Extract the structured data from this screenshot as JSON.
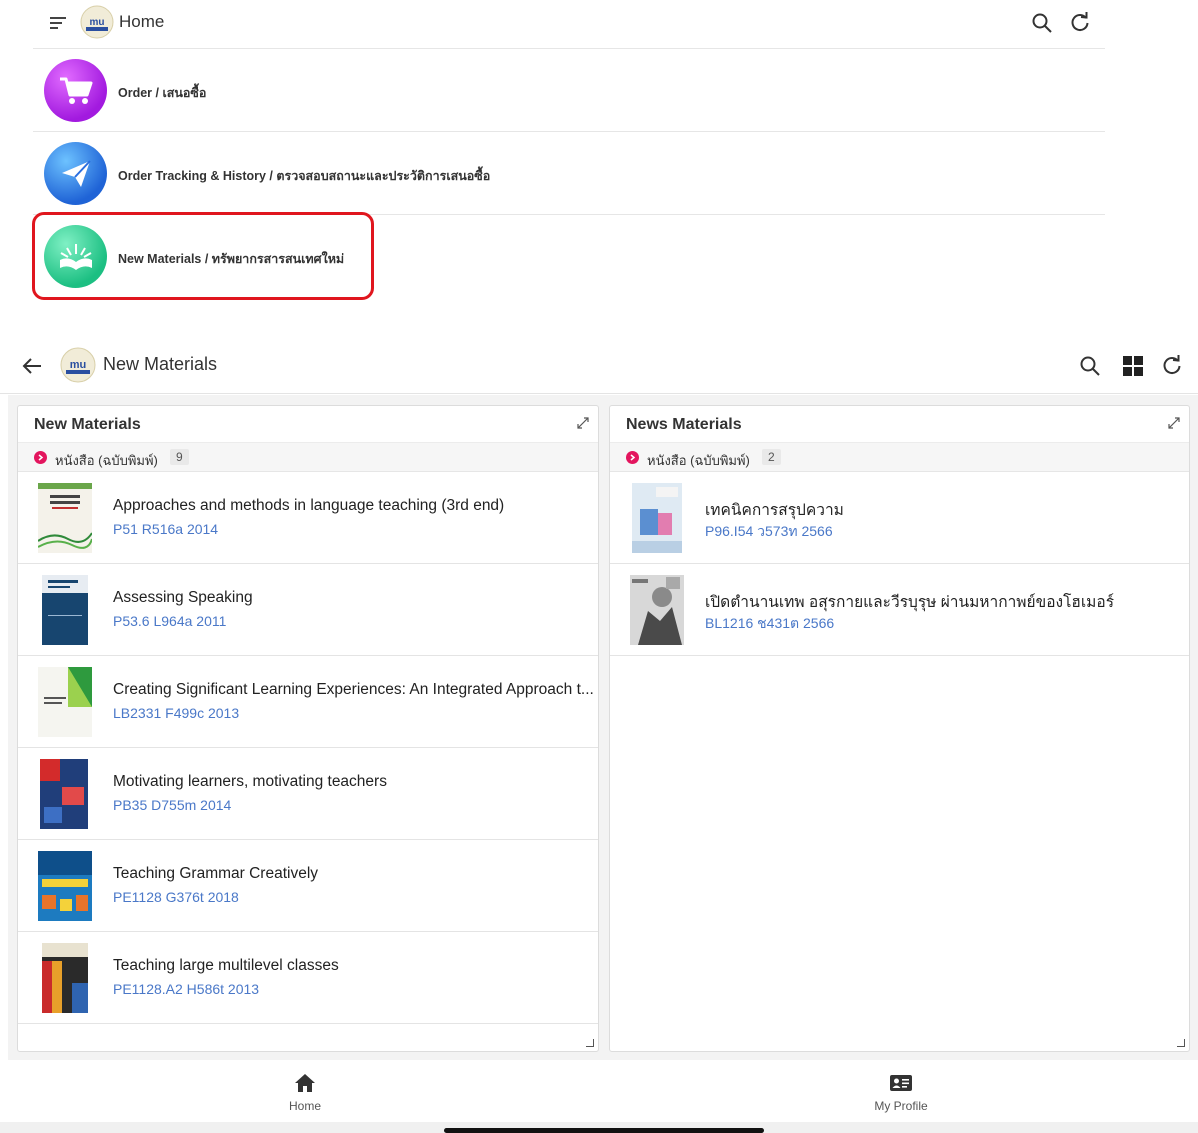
{
  "home": {
    "title": "Home",
    "menu": [
      {
        "label": "Order / เสนอซื้อ",
        "icon": "shopping-cart-icon"
      },
      {
        "label": "Order Tracking & History / ตรวจสอบสถานะและประวัติการเสนอซื้อ",
        "icon": "paper-plane-icon"
      },
      {
        "label": "New Materials / ทรัพยากรสารสนเทศใหม่",
        "icon": "open-book-icon"
      }
    ],
    "highlight_color": "#e0161e"
  },
  "new_materials": {
    "title": "New Materials",
    "panels": [
      {
        "title": "New Materials",
        "category": "หนังสือ (ฉบับพิมพ์)",
        "count": "9",
        "items": [
          {
            "title": "Approaches and methods in language teaching (3rd end)",
            "call": "P51 R516a 2014"
          },
          {
            "title": "Assessing Speaking",
            "call": "P53.6 L964a 2011"
          },
          {
            "title": "Creating Significant Learning Experiences: An Integrated Approach t...",
            "call": "LB2331 F499c 2013"
          },
          {
            "title": "Motivating learners, motivating teachers",
            "call": "PB35 D755m 2014"
          },
          {
            "title": "Teaching Grammar Creatively",
            "call": "PE1128 G376t 2018"
          },
          {
            "title": "Teaching large multilevel classes",
            "call": "PE1128.A2 H586t 2013"
          }
        ]
      },
      {
        "title": "News Materials",
        "category": "หนังสือ (ฉบับพิมพ์)",
        "count": "2",
        "items": [
          {
            "title": "เทคนิคการสรุปความ",
            "call": "P96.I54 ว573ท 2566"
          },
          {
            "title": "เปิดตำนานเทพ อสุรกายและวีรบุรุษ ผ่านมหากาพย์ของโฮเมอร์",
            "call": "BL1216 ช431ต 2566"
          }
        ]
      }
    ]
  },
  "bottom_nav": [
    {
      "label": "Home",
      "icon": "home-icon"
    },
    {
      "label": "My Profile",
      "icon": "profile-card-icon"
    }
  ],
  "colors": {
    "accent_link": "#4a78c8",
    "category_bullet": "#e3155e"
  }
}
